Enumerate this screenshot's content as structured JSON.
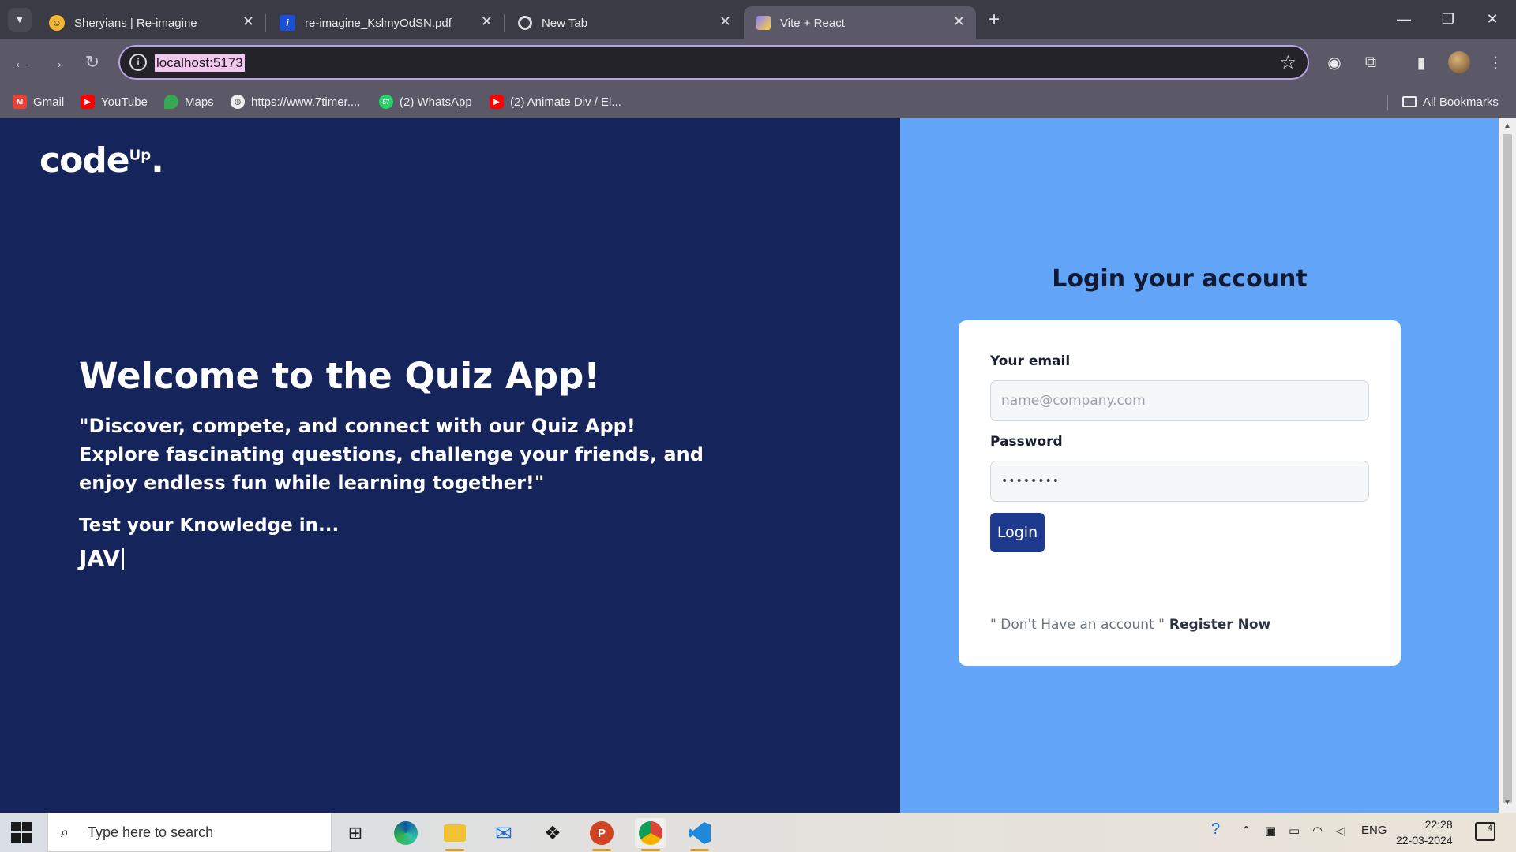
{
  "browser": {
    "tabs": [
      {
        "title": "Sheryians | Re-imagine",
        "icon": "sheryians-favicon",
        "active": false
      },
      {
        "title": "re-imagine_KslmyOdSN.pdf",
        "icon": "pdf-info-favicon",
        "active": false
      },
      {
        "title": "New Tab",
        "icon": "chrome-favicon",
        "active": false
      },
      {
        "title": "Vite + React",
        "icon": "vite-favicon",
        "active": true
      }
    ],
    "url": "localhost:5173",
    "bookmarks": [
      {
        "label": "Gmail",
        "icon": "gmail-icon",
        "color": "#ea4335"
      },
      {
        "label": "YouTube",
        "icon": "youtube-icon",
        "color": "#ff0000"
      },
      {
        "label": "Maps",
        "icon": "maps-icon",
        "color": "#34a853"
      },
      {
        "label": "https://www.7timer....",
        "icon": "globe-icon",
        "color": "#5b5868"
      },
      {
        "label": "(2) WhatsApp",
        "icon": "whatsapp-icon",
        "color": "#25d366",
        "badge": "57"
      },
      {
        "label": "(2) Animate Div / El...",
        "icon": "youtube-icon",
        "color": "#ff0000"
      }
    ],
    "all_bookmarks": "All Bookmarks"
  },
  "page": {
    "logo": {
      "text": "code",
      "sup": "Up",
      "dot": "."
    },
    "welcome": "Welcome to the Quiz App!",
    "tagline": "\"Discover, compete, and connect with our Quiz App! Explore fascinating questions, challenge your friends, and enjoy endless fun while learning together!\"",
    "test_label": "Test your Knowledge in...",
    "typed_text": "JAV",
    "login": {
      "title": "Login your account",
      "email_label": "Your email",
      "email_placeholder": "name@company.com",
      "password_label": "Password",
      "password_value": "••••••••",
      "button": "Login",
      "register_prompt": "\" Don't Have an account \"",
      "register_link": "Register Now"
    },
    "colors": {
      "left_bg": "#15245a",
      "right_bg": "#62a4f8",
      "button": "#1d3a8f"
    }
  },
  "taskbar": {
    "search_placeholder": "Type here to search",
    "apps": [
      "task-view-icon",
      "edge-icon",
      "file-explorer-icon",
      "mail-icon",
      "dropbox-icon",
      "powerpoint-icon",
      "chrome-icon",
      "vscode-icon"
    ],
    "language": "ENG",
    "time": "22:28",
    "date": "22-03-2024",
    "notifications": "4"
  }
}
